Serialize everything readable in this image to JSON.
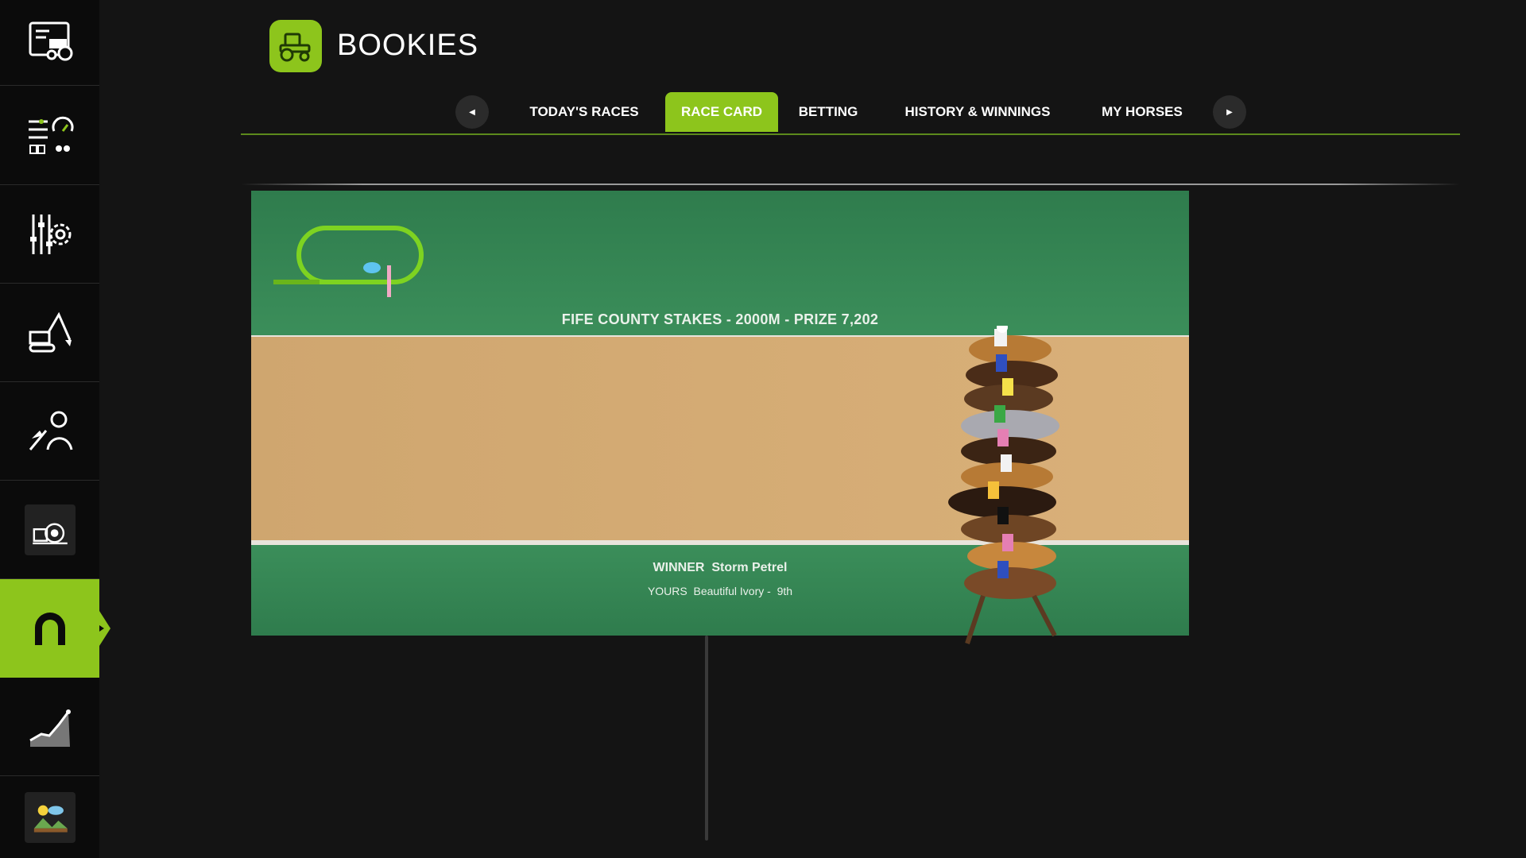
{
  "app": {
    "title": "BOOKIES"
  },
  "sidebar": {
    "items": [
      {
        "name": "farm-dashboard",
        "icon": "tractor-document-icon"
      },
      {
        "name": "settings-gauges",
        "icon": "sliders-gauge-icon"
      },
      {
        "name": "controls",
        "icon": "sliders-gear-icon"
      },
      {
        "name": "construction",
        "icon": "excavator-icon"
      },
      {
        "name": "workers",
        "icon": "worker-icon"
      },
      {
        "name": "production",
        "icon": "factory-machine-icon"
      },
      {
        "name": "bookies",
        "icon": "horseshoe-icon",
        "active": true
      },
      {
        "name": "statistics",
        "icon": "chart-icon"
      },
      {
        "name": "environment",
        "icon": "weather-landscape-icon"
      }
    ]
  },
  "tabs": {
    "items": [
      {
        "label": "TODAY'S RACES"
      },
      {
        "label": "RACE CARD",
        "active": true
      },
      {
        "label": "BETTING"
      },
      {
        "label": "HISTORY & WINNINGS"
      },
      {
        "label": "MY HORSES"
      }
    ],
    "prev_icon": "arrow-left-icon",
    "next_icon": "arrow-right-icon"
  },
  "race": {
    "name": "FIFE COUNTY STAKES",
    "distance": "2000M",
    "prize": "PRIZE 7,202",
    "info_text": "FIFE COUNTY STAKES  -  2000M  -  PRIZE 7,202",
    "winner_label": "WINNER",
    "winner_name": "Storm Petrel",
    "yours_label": "YOURS",
    "yours_horse": "Beautiful Ivory",
    "yours_place": "9th"
  },
  "colors": {
    "accent": "#8dc51c",
    "background": "#141414",
    "sidebar": "#0b0b0b",
    "turf": "#2e7d4f",
    "track": "#d4ab74",
    "rail": "#e8e4dc",
    "minimap_track": "#7ed321",
    "minimap_marker": "#5ec4f0",
    "finish_post": "#f2a9c4"
  }
}
